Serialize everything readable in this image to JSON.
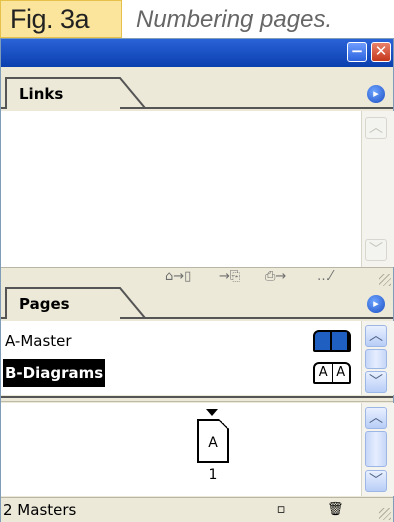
{
  "caption": {
    "label": "Fig. 3a",
    "text": "Numbering pages."
  },
  "window": {
    "minimize_glyph": "−",
    "close_glyph": "✕"
  },
  "links_panel": {
    "tab_label": "Links",
    "menu_glyph": "▸",
    "scroll_up": "︿",
    "scroll_down": "﹀",
    "toolbar": {
      "relink_glyph": "⌂→▯",
      "goto_glyph": "→⎘",
      "update_glyph": "⎙→",
      "edit_glyph": "…⁄"
    }
  },
  "pages_panel": {
    "tab_label": "Pages",
    "menu_glyph": "▸",
    "masters": [
      {
        "name": "A-Master",
        "pages": [
          "",
          ""
        ],
        "selected": false
      },
      {
        "name": "B-Diagrams",
        "pages": [
          "A",
          "A"
        ],
        "selected": true
      }
    ],
    "page": {
      "master_letter": "A",
      "number": "1"
    },
    "scroll_up": "︿",
    "scroll_down": "﹀",
    "status_text": "2 Masters",
    "new_page_glyph": "▫",
    "trash_glyph": "🗑"
  },
  "colors": {
    "caption_bg": "#fbe49b",
    "titlebar": "#0a3fae",
    "panel_bg": "#ece9d8",
    "selection": "#000000",
    "master_icon_fill": "#1f5fc2"
  }
}
